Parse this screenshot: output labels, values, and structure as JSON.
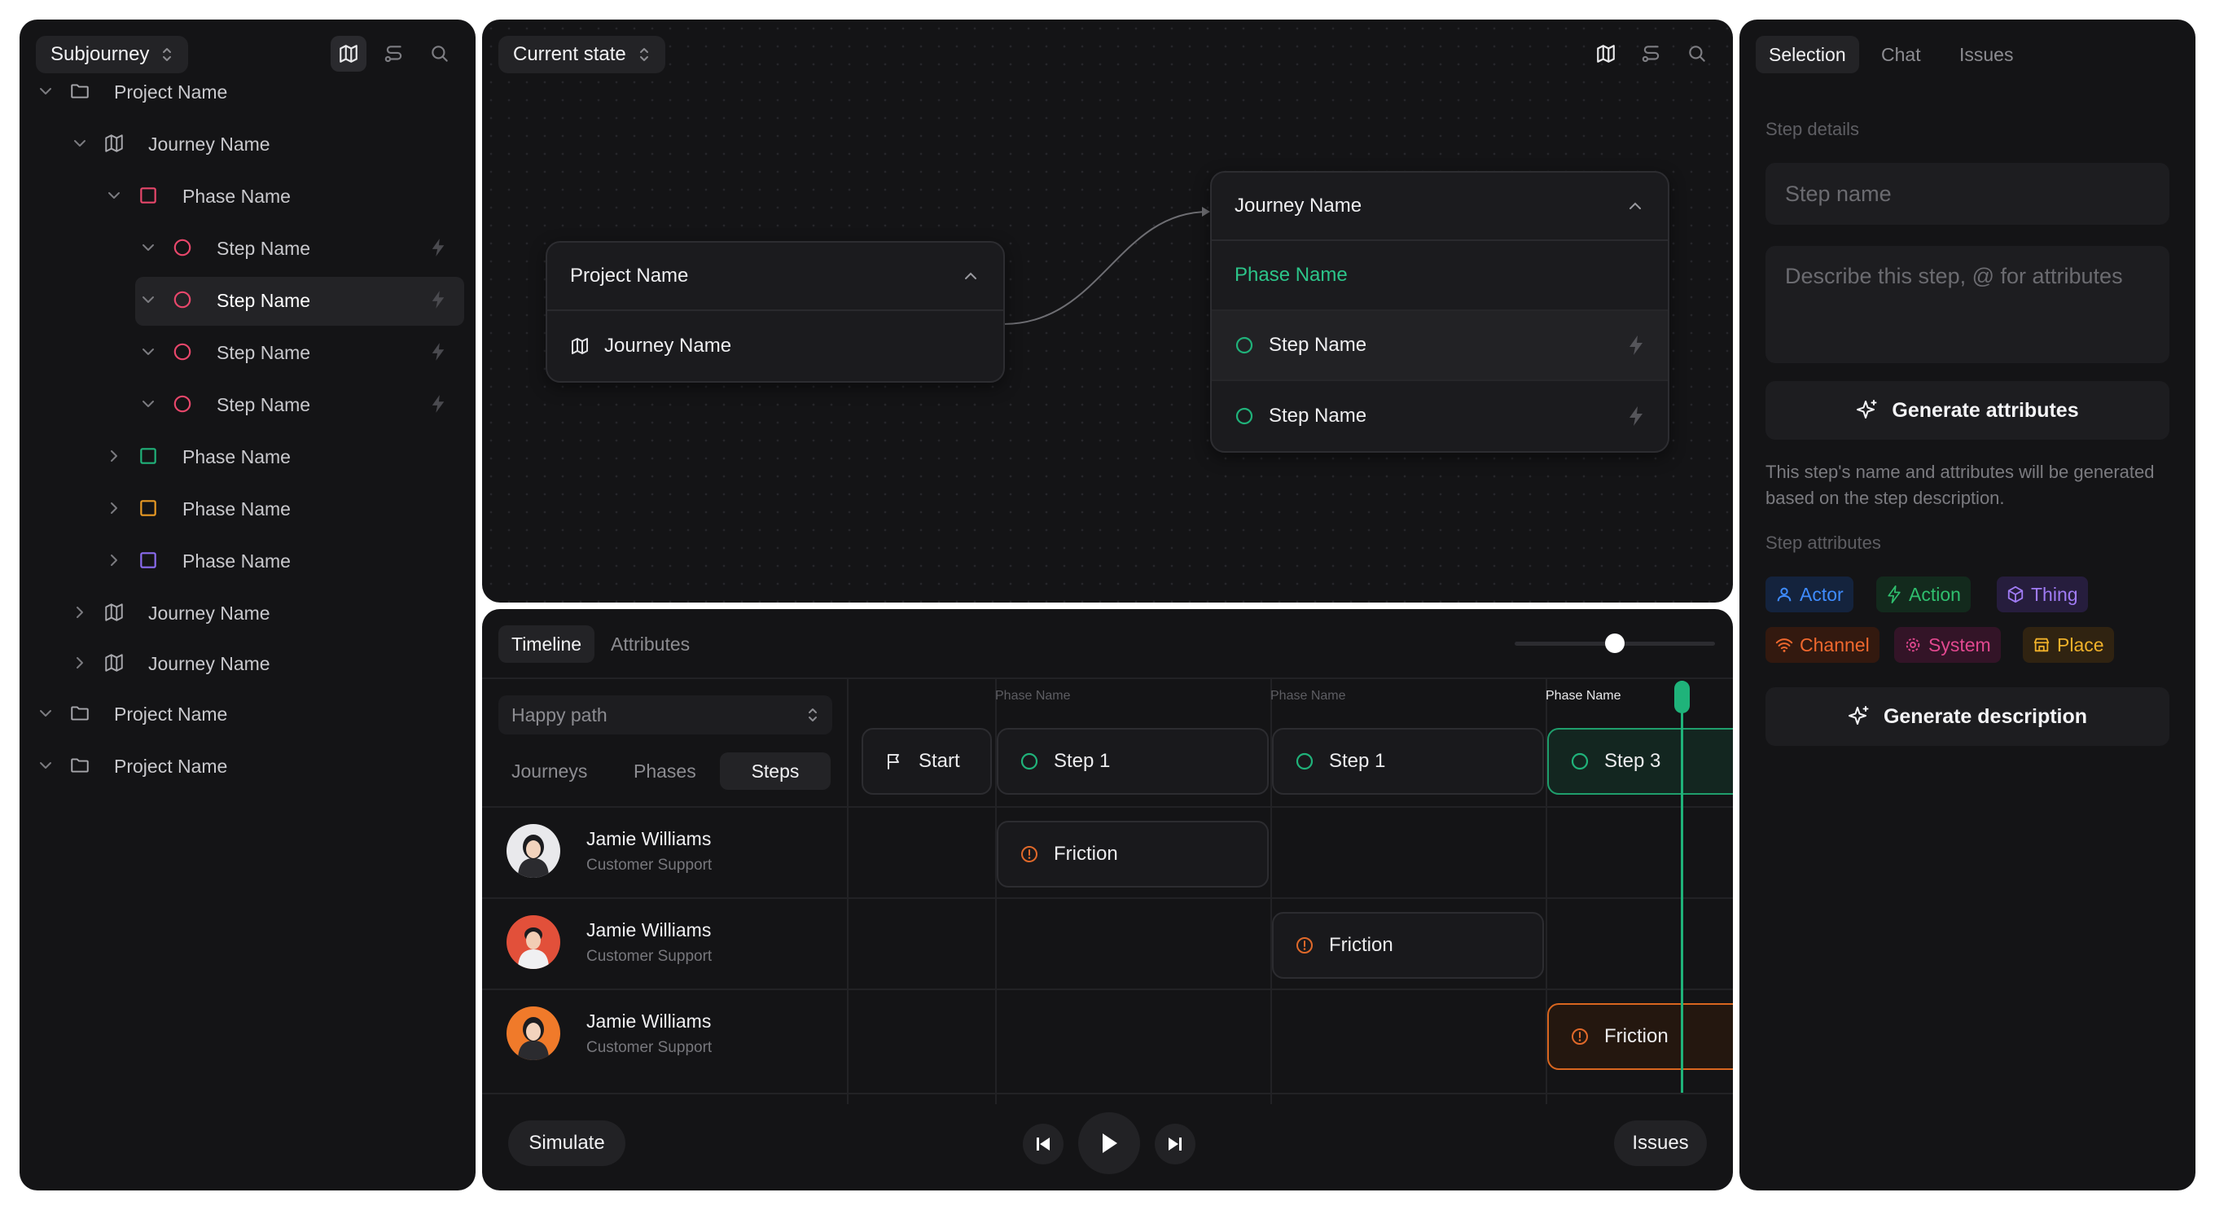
{
  "left_panel": {
    "selector_label": "Subjourney",
    "tree": [
      {
        "label": "Project Name",
        "type": "project",
        "expanded": true
      },
      {
        "label": "Journey Name",
        "type": "journey",
        "expanded": true
      },
      {
        "label": "Phase Name",
        "type": "phase",
        "color": "#e8476b",
        "expanded": true
      },
      {
        "label": "Step Name",
        "type": "step",
        "color": "#e8476b"
      },
      {
        "label": "Step Name",
        "type": "step",
        "color": "#e8476b",
        "selected": true
      },
      {
        "label": "Step Name",
        "type": "step",
        "color": "#e8476b"
      },
      {
        "label": "Step Name",
        "type": "step",
        "color": "#e8476b"
      },
      {
        "label": "Phase Name",
        "type": "phase",
        "color": "#20b27a",
        "expanded": false
      },
      {
        "label": "Phase Name",
        "type": "phase",
        "color": "#e99a24",
        "expanded": false
      },
      {
        "label": "Phase Name",
        "type": "phase",
        "color": "#8b6cf0",
        "expanded": false
      },
      {
        "label": "Journey Name",
        "type": "journey",
        "expanded": false
      },
      {
        "label": "Journey Name",
        "type": "journey",
        "expanded": false
      },
      {
        "label": "Project Name",
        "type": "project",
        "expanded": true
      },
      {
        "label": "Project Name",
        "type": "project",
        "expanded": true
      }
    ]
  },
  "canvas": {
    "selector_label": "Current state",
    "project_node": {
      "title": "Project Name",
      "rows": [
        "Journey Name"
      ]
    },
    "journey_node": {
      "title": "Journey Name",
      "phase": "Phase Name",
      "steps": [
        "Step Name",
        "Step Name"
      ]
    }
  },
  "timeline": {
    "tabs": [
      "Timeline",
      "Attributes"
    ],
    "slider_value": 0.5,
    "path_select": "Happy path",
    "view_tabs": [
      "Journeys",
      "Phases",
      "Steps"
    ],
    "phase_labels": [
      "Phase Name",
      "Phase Name",
      "Phase Name"
    ],
    "steps": [
      "Start",
      "Step 1",
      "Step 1",
      "Step 3"
    ],
    "people": [
      {
        "name": "Jamie Williams",
        "role": "Customer Support",
        "friction": "Friction"
      },
      {
        "name": "Jamie Williams",
        "role": "Customer Support",
        "friction": "Friction"
      },
      {
        "name": "Jamie Williams",
        "role": "Customer Support",
        "friction": "Friction"
      }
    ],
    "simulate_label": "Simulate",
    "issues_label": "Issues"
  },
  "right_panel": {
    "tabs": [
      "Selection",
      "Chat",
      "Issues"
    ],
    "step_details_label": "Step details",
    "step_name_placeholder": "Step name",
    "description_placeholder": "Describe this step, @ for attributes",
    "generate_attributes_label": "Generate attributes",
    "note": "This step's name and attributes will be generated based on the step description.",
    "step_attributes_label": "Step attributes",
    "chips": [
      {
        "label": "Actor",
        "color": "#3f8cff",
        "bg": "#14233d",
        "icon": "person-icon"
      },
      {
        "label": "Action",
        "color": "#2fbf6e",
        "bg": "#132a1d",
        "icon": "bolt-icon"
      },
      {
        "label": "Thing",
        "color": "#a07bf5",
        "bg": "#261d3d",
        "icon": "cube-icon"
      },
      {
        "label": "Channel",
        "color": "#f0682e",
        "bg": "#33190f",
        "icon": "wifi-icon"
      },
      {
        "label": "System",
        "color": "#e1488f",
        "bg": "#331427",
        "icon": "gear-icon"
      },
      {
        "label": "Place",
        "color": "#f0b12a",
        "bg": "#302311",
        "icon": "store-icon"
      }
    ],
    "generate_description_label": "Generate description"
  },
  "colors": {
    "accent_green": "#20b27a",
    "friction_orange": "#e0692a",
    "playhead": "#1fb37a"
  }
}
